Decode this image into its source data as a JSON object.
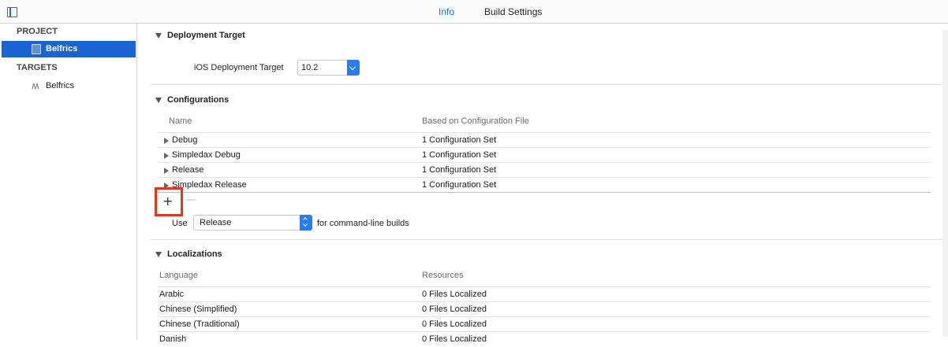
{
  "tabs": {
    "info": "Info",
    "build_settings": "Build Settings"
  },
  "sidebar": {
    "project_header": "PROJECT",
    "project_item": "Belfrics",
    "targets_header": "TARGETS",
    "target_item": "Belfrics"
  },
  "deployment": {
    "title": "Deployment Target",
    "label": "iOS Deployment Target",
    "value": "10.2"
  },
  "configurations": {
    "title": "Configurations",
    "col_name": "Name",
    "col_file": "Based on Configuration File",
    "rows": [
      {
        "name": "Debug",
        "file": "1 Configuration Set"
      },
      {
        "name": "Simpledax Debug",
        "file": "1 Configuration Set"
      },
      {
        "name": "Release",
        "file": "1 Configuration Set"
      },
      {
        "name": "Simpledax Release",
        "file": "1 Configuration Set"
      }
    ],
    "add": "+",
    "remove": "—",
    "use_label": "Use",
    "use_value": "Release",
    "use_suffix": "for command-line builds"
  },
  "localizations": {
    "title": "Localizations",
    "col_language": "Language",
    "col_resources": "Resources",
    "rows": [
      {
        "language": "Arabic",
        "resources": "0 Files Localized"
      },
      {
        "language": "Chinese (Simplified)",
        "resources": "0 Files Localized"
      },
      {
        "language": "Chinese (Traditional)",
        "resources": "0 Files Localized"
      },
      {
        "language": "Danish",
        "resources": "0 Files Localized"
      }
    ]
  },
  "colors": {
    "accent": "#1963d2",
    "highlight": "#e8341c"
  }
}
